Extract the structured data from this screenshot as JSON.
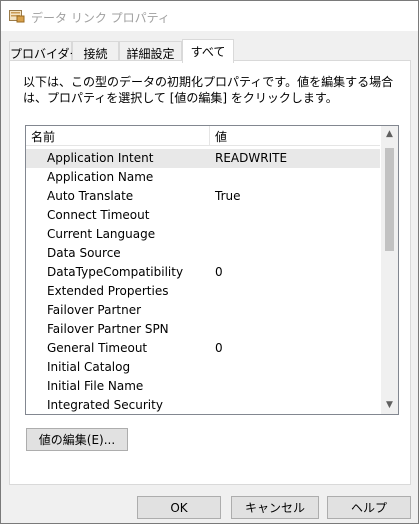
{
  "window": {
    "title": "データ リンク プロパティ"
  },
  "tabs": [
    {
      "label": "プロバイダー"
    },
    {
      "label": "接続"
    },
    {
      "label": "詳細設定"
    },
    {
      "label": "すべて"
    }
  ],
  "active_tab": "すべて",
  "description": "以下は、この型のデータの初期化プロパティです。値を編集する場合は、プロパティを選択して [値の編集] をクリックします。",
  "grid": {
    "columns": {
      "name": "名前",
      "value": "値"
    },
    "rows": [
      {
        "name": "Application Intent",
        "value": "READWRITE"
      },
      {
        "name": "Application Name",
        "value": ""
      },
      {
        "name": "Auto Translate",
        "value": "True"
      },
      {
        "name": "Connect Timeout",
        "value": ""
      },
      {
        "name": "Current Language",
        "value": ""
      },
      {
        "name": "Data Source",
        "value": ""
      },
      {
        "name": "DataTypeCompatibility",
        "value": "0"
      },
      {
        "name": "Extended Properties",
        "value": ""
      },
      {
        "name": "Failover Partner",
        "value": ""
      },
      {
        "name": "Failover Partner SPN",
        "value": ""
      },
      {
        "name": "General Timeout",
        "value": "0"
      },
      {
        "name": "Initial Catalog",
        "value": ""
      },
      {
        "name": "Initial File Name",
        "value": ""
      },
      {
        "name": "Integrated Security",
        "value": ""
      }
    ],
    "selected_row": "Application Intent"
  },
  "buttons": {
    "edit": "値の編集(E)...",
    "ok": "OK",
    "cancel": "キャンセル",
    "help": "ヘルプ"
  },
  "icons": {
    "title": "data-link-icon",
    "scroll_up": "chevron-up-icon",
    "scroll_down": "chevron-down-icon"
  },
  "colors": {
    "selected_row": "#e8e8e8",
    "dialog_bg": "#f0f0f0",
    "button_bg": "#e1e1e1"
  }
}
